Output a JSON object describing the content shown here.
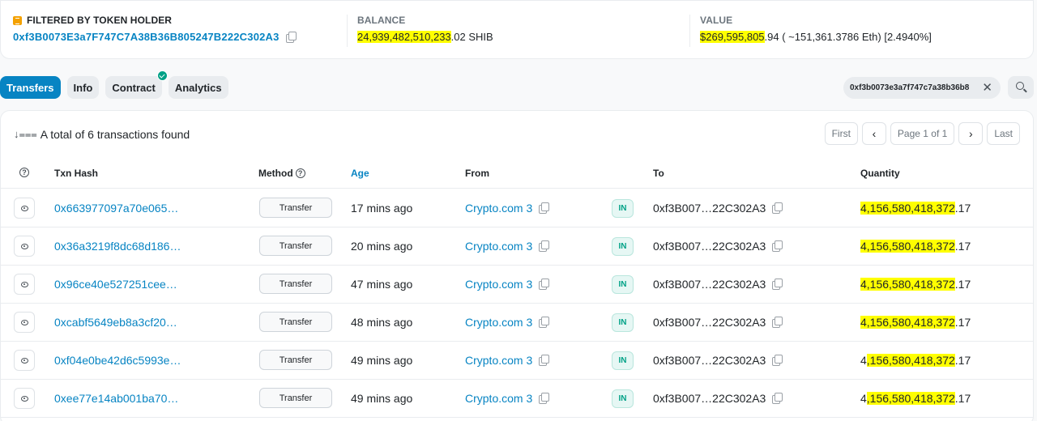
{
  "summary": {
    "filter_label": "FILTERED BY TOKEN HOLDER",
    "holder_address": "0xf3B0073E3a7F747C7A38B36B805247B222C302A3",
    "balance_label": "BALANCE",
    "balance_highlight": "24,939,482,510,233",
    "balance_rest": ".02 SHIB",
    "value_label": "VALUE",
    "value_highlight": "$269,595,805",
    "value_rest": ".94 ( ~151,361.3786 Eth) [2.4940%]"
  },
  "tabs": [
    {
      "label": "Transfers",
      "active": true
    },
    {
      "label": "Info",
      "active": false
    },
    {
      "label": "Contract",
      "active": false
    },
    {
      "label": "Analytics",
      "active": false
    }
  ],
  "filter_chip": {
    "address": "0xf3b0073e3a7f747c7a38b36b8",
    "close": "✕"
  },
  "table": {
    "total_text": "A total of 6 transactions found",
    "pager": {
      "first": "First",
      "prev": "‹",
      "page": "Page 1 of 1",
      "next": "›",
      "last": "Last"
    },
    "headers": {
      "help": "?",
      "txn_hash": "Txn Hash",
      "method": "Method",
      "age": "Age",
      "from": "From",
      "to": "To",
      "quantity": "Quantity"
    },
    "rows": [
      {
        "hash": "0x663977097a70e065…",
        "method": "Transfer",
        "age": "17 mins ago",
        "from": "Crypto.com 3",
        "dir": "IN",
        "to": "0xf3B007…22C302A3",
        "qty_pre": "",
        "qty_hl": "4,156,580,418,372",
        "qty_post": ".17"
      },
      {
        "hash": "0x36a3219f8dc68d186…",
        "method": "Transfer",
        "age": "20 mins ago",
        "from": "Crypto.com 3",
        "dir": "IN",
        "to": "0xf3B007…22C302A3",
        "qty_pre": "",
        "qty_hl": "4,156,580,418,372",
        "qty_post": ".17"
      },
      {
        "hash": "0x96ce40e527251cee…",
        "method": "Transfer",
        "age": "47 mins ago",
        "from": "Crypto.com 3",
        "dir": "IN",
        "to": "0xf3B007…22C302A3",
        "qty_pre": "",
        "qty_hl": "4,156,580,418,372",
        "qty_post": ".17"
      },
      {
        "hash": "0xcabf5649eb8a3cf20…",
        "method": "Transfer",
        "age": "48 mins ago",
        "from": "Crypto.com 3",
        "dir": "IN",
        "to": "0xf3B007…22C302A3",
        "qty_pre": "",
        "qty_hl": "4,156,580,418,372",
        "qty_post": ".17"
      },
      {
        "hash": "0xf04e0be42d6c5993e…",
        "method": "Transfer",
        "age": "49 mins ago",
        "from": "Crypto.com 3",
        "dir": "IN",
        "to": "0xf3B007…22C302A3",
        "qty_pre": "4",
        "qty_hl": ",156,580,418,372",
        "qty_post": ".17"
      },
      {
        "hash": "0xee77e14ab001ba70…",
        "method": "Transfer",
        "age": "49 mins ago",
        "from": "Crypto.com 3",
        "dir": "IN",
        "to": "0xf3B007…22C302A3",
        "qty_pre": "4",
        "qty_hl": ",156,580,418,372",
        "qty_post": ".17"
      }
    ]
  }
}
